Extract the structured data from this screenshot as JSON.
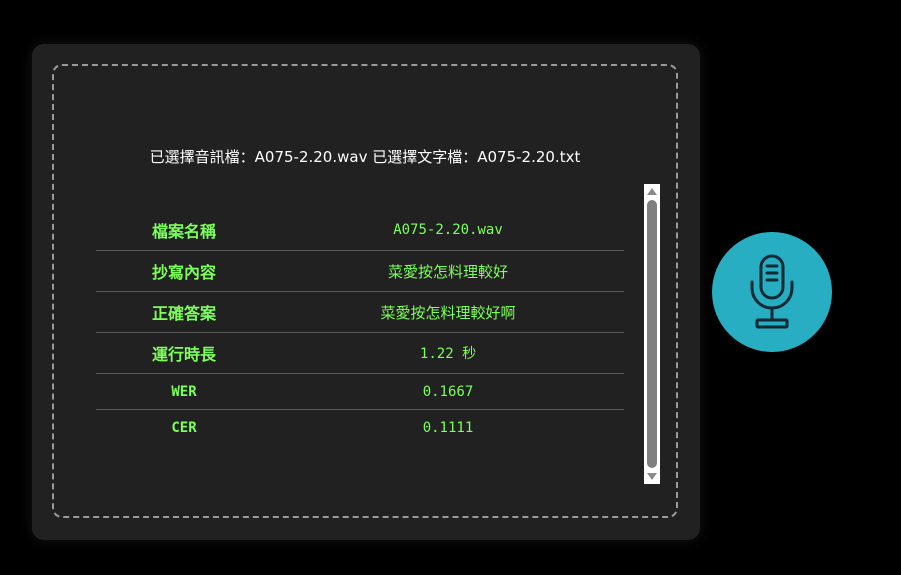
{
  "selection": {
    "text": "已選擇音訊檔：A075-2.20.wav 已選擇文字檔：A075-2.20.txt"
  },
  "results": [
    {
      "label": "檔案名稱",
      "value": "A075-2.20.wav"
    },
    {
      "label": "抄寫內容",
      "value": "菜愛按怎料理較好"
    },
    {
      "label": "正確答案",
      "value": "菜愛按怎料理較好啊"
    },
    {
      "label": "運行時長",
      "value": "1.22 秒"
    },
    {
      "label": "WER",
      "value": "0.1667"
    },
    {
      "label": "CER",
      "value": "0.1111"
    }
  ],
  "colors": {
    "accent_green": "#7dff5a",
    "mic_button": "#27aec3",
    "panel": "#212121"
  },
  "icons": {
    "mic": "microphone-icon"
  }
}
